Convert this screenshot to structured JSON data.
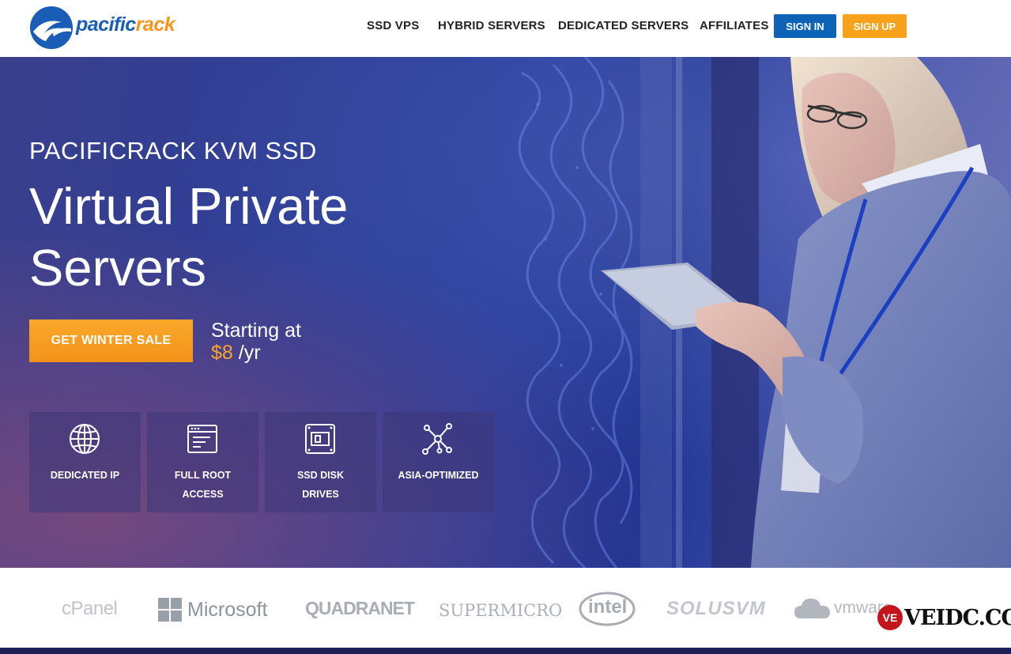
{
  "header": {
    "logo_text_1": "pacific",
    "logo_text_2": "rack",
    "nav": [
      "SSD VPS",
      "HYBRID SERVERS",
      "DEDICATED SERVERS",
      "AFFILIATES"
    ],
    "sign_in": "SIGN IN",
    "sign_up": "SIGN UP"
  },
  "hero": {
    "subtitle": "PACIFICRACK KVM SSD",
    "title_line1": "Virtual Private",
    "title_line2": "Servers",
    "cta": "GET WINTER SALE",
    "starting": "Starting at",
    "price": "$8",
    "period": " /yr"
  },
  "features": [
    {
      "label": "DEDICATED IP",
      "icon": "globe-icon"
    },
    {
      "label": "FULL ROOT ACCESS",
      "icon": "terminal-window-icon"
    },
    {
      "label": "SSD DISK DRIVES",
      "icon": "ssd-drive-icon"
    },
    {
      "label": "ASIA-OPTIMIZED",
      "icon": "network-nodes-icon"
    }
  ],
  "partners": [
    "cPanel",
    "Microsoft",
    "QUADRANET",
    "SUPERMICRO",
    "intel",
    "SOLUSVM",
    "vmware"
  ],
  "watermark": {
    "badge": "VE",
    "text": "VEIDC.COM"
  },
  "colors": {
    "accent": "#f7a21a",
    "brand_blue": "#0d63b6",
    "hero_blue": "#243c9c"
  }
}
